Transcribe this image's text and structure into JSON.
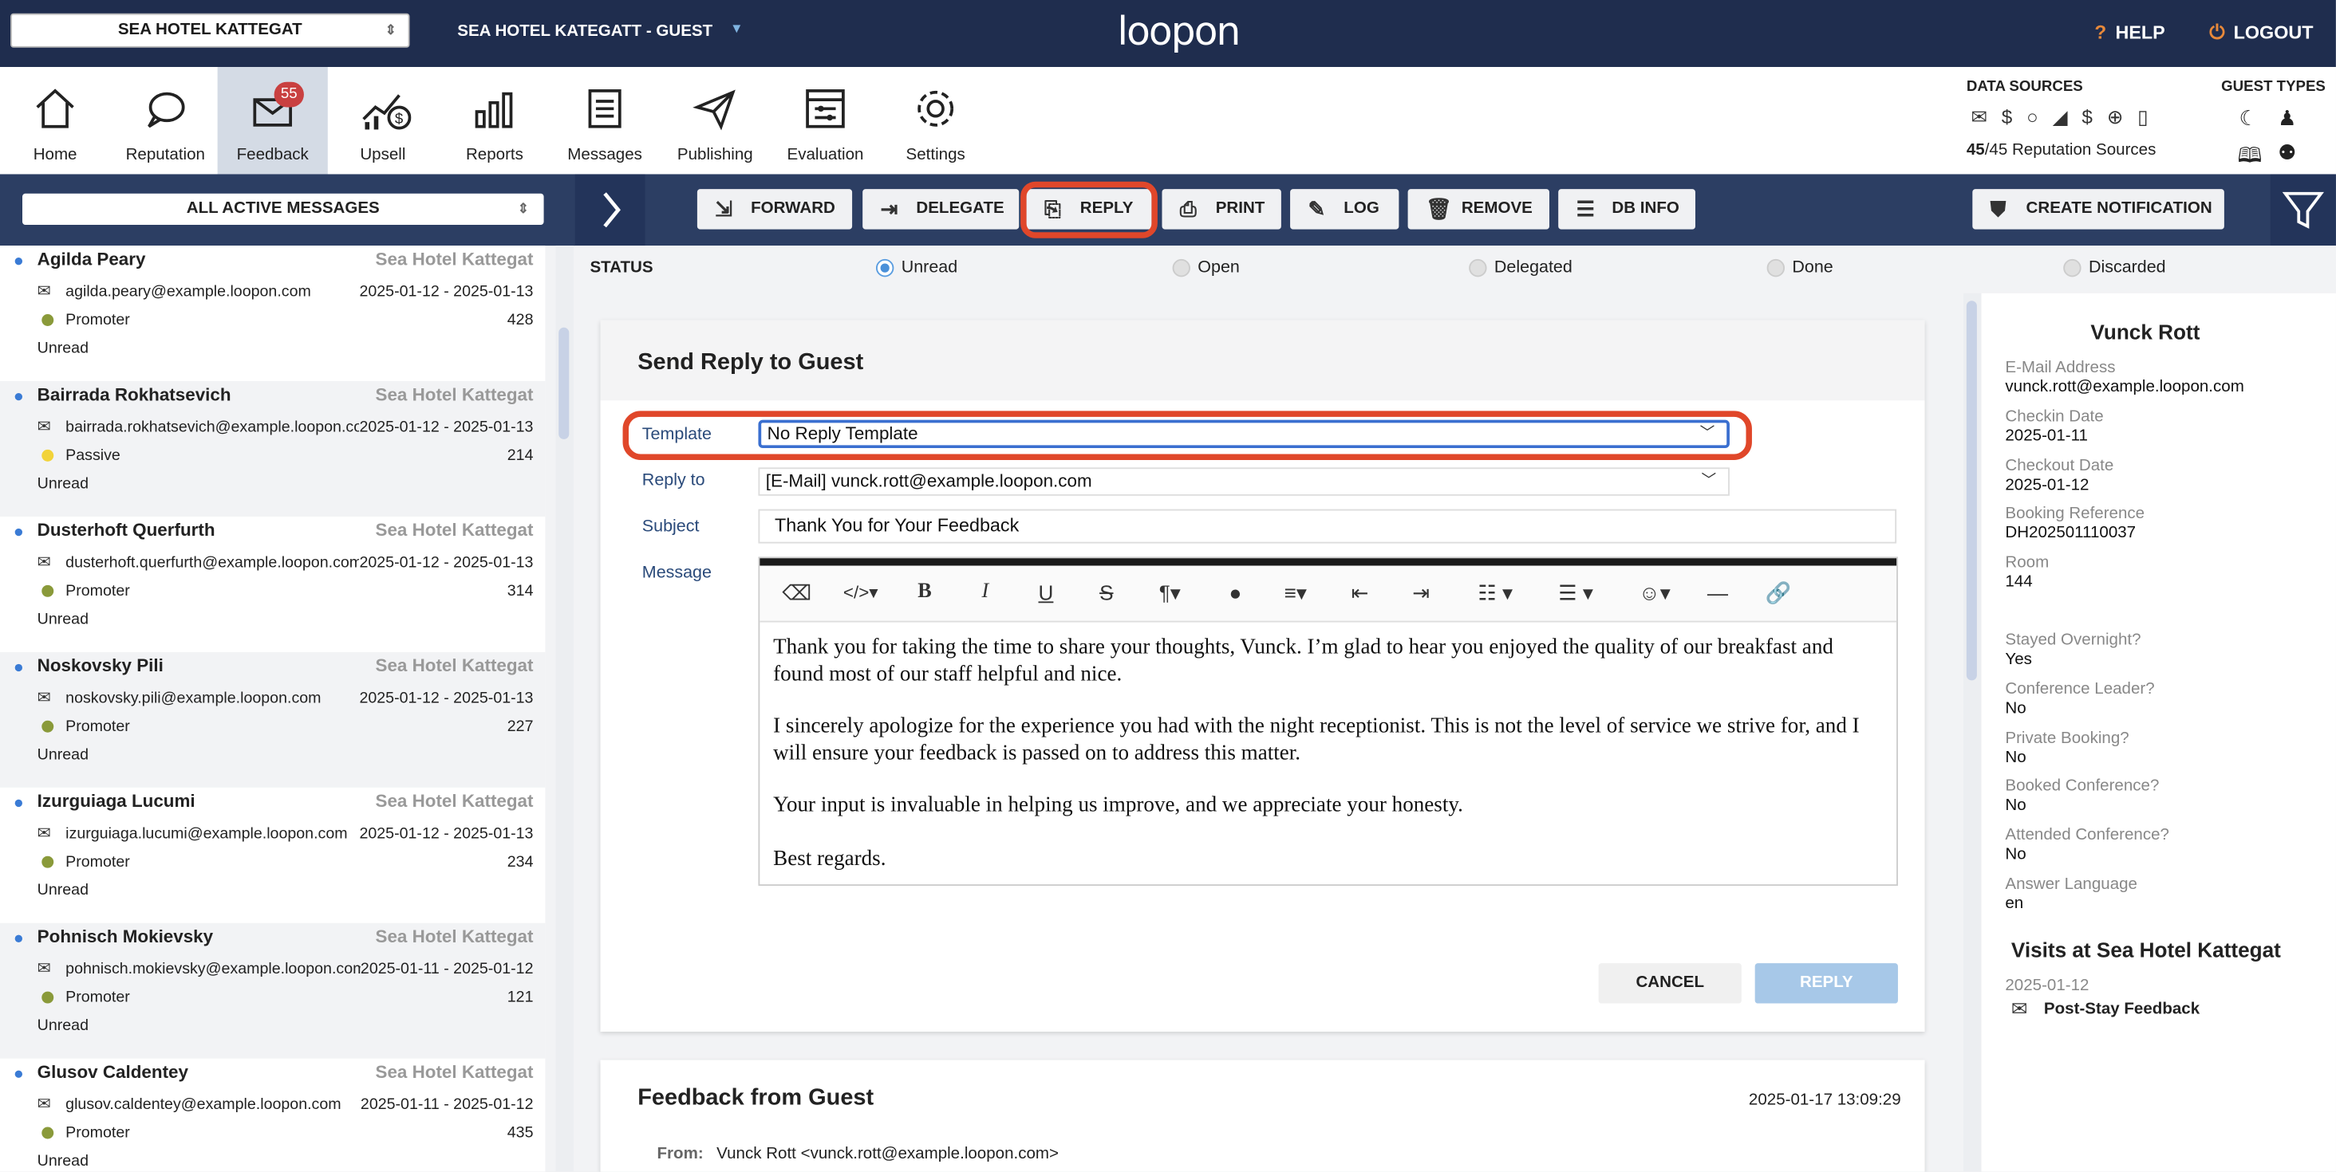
{
  "header": {
    "hotel_select": "SEA HOTEL KATTEGAT",
    "guest_title": "SEA HOTEL KATEGATT - GUEST",
    "logo": "loopon",
    "help": "HELP",
    "logout": "LOGOUT"
  },
  "nav": {
    "items": [
      {
        "label": "Home",
        "icon": "home-icon"
      },
      {
        "label": "Reputation",
        "icon": "chat-bubble-icon"
      },
      {
        "label": "Feedback",
        "icon": "feedback-inbox-icon",
        "badge": "55"
      },
      {
        "label": "Upsell",
        "icon": "upsell-chart-icon"
      },
      {
        "label": "Reports",
        "icon": "bar-chart-icon"
      },
      {
        "label": "Messages",
        "icon": "document-icon"
      },
      {
        "label": "Publishing",
        "icon": "paper-plane-icon"
      },
      {
        "label": "Evaluation",
        "icon": "evaluation-icon"
      },
      {
        "label": "Settings",
        "icon": "gear-icon"
      }
    ],
    "data_sources_title": "DATA SOURCES",
    "guest_types_title": "GUEST TYPES",
    "data_sources_icons": "✉ $ ○ ◢ $ ⊕ ▯",
    "reputation_sources_count": "45",
    "reputation_sources_rest": "/45 Reputation Sources"
  },
  "toolbar": {
    "message_filter": "ALL ACTIVE MESSAGES",
    "forward": "FORWARD",
    "delegate": "DELEGATE",
    "reply": "REPLY",
    "print": "PRINT",
    "log": "LOG",
    "remove": "REMOVE",
    "db_info": "DB INFO",
    "create_notification": "CREATE NOTIFICATION"
  },
  "messages": [
    {
      "name": "Agilda Peary",
      "hotel": "Sea Hotel Kattegat",
      "email": "agilda.peary@example.loopon.com",
      "dates": "2025-01-12 - 2025-01-13",
      "type": "Promoter",
      "type_color": "#8a9a3a",
      "number": "428",
      "state": "Unread"
    },
    {
      "name": "Bairrada Rokhatsevich",
      "hotel": "Sea Hotel Kattegat",
      "email": "bairrada.rokhatsevich@example.loopon.com",
      "dates": "2025-01-12 - 2025-01-13",
      "type": "Passive",
      "type_color": "#f2d33a",
      "number": "214",
      "state": "Unread"
    },
    {
      "name": "Dusterhoft Querfurth",
      "hotel": "Sea Hotel Kattegat",
      "email": "dusterhoft.querfurth@example.loopon.com",
      "dates": "2025-01-12 - 2025-01-13",
      "type": "Promoter",
      "type_color": "#8a9a3a",
      "number": "314",
      "state": "Unread"
    },
    {
      "name": "Noskovsky Pili",
      "hotel": "Sea Hotel Kattegat",
      "email": "noskovsky.pili@example.loopon.com",
      "dates": "2025-01-12 - 2025-01-13",
      "type": "Promoter",
      "type_color": "#8a9a3a",
      "number": "227",
      "state": "Unread"
    },
    {
      "name": "Izurguiaga Lucumi",
      "hotel": "Sea Hotel Kattegat",
      "email": "izurguiaga.lucumi@example.loopon.com",
      "dates": "2025-01-12 - 2025-01-13",
      "type": "Promoter",
      "type_color": "#8a9a3a",
      "number": "234",
      "state": "Unread"
    },
    {
      "name": "Pohnisch Mokievsky",
      "hotel": "Sea Hotel Kattegat",
      "email": "pohnisch.mokievsky@example.loopon.com",
      "dates": "2025-01-11 - 2025-01-12",
      "type": "Promoter",
      "type_color": "#8a9a3a",
      "number": "121",
      "state": "Unread"
    },
    {
      "name": "Glusov Caldentey",
      "hotel": "Sea Hotel Kattegat",
      "email": "glusov.caldentey@example.loopon.com",
      "dates": "2025-01-11 - 2025-01-12",
      "type": "Promoter",
      "type_color": "#8a9a3a",
      "number": "435",
      "state": "Unread"
    }
  ],
  "status": {
    "label": "STATUS",
    "options": [
      "Unread",
      "Open",
      "Delegated",
      "Done",
      "Discarded"
    ],
    "selected": "Unread"
  },
  "reply_form": {
    "title": "Send Reply to Guest",
    "template_label": "Template",
    "template_value": "No Reply Template",
    "reply_to_label": "Reply to",
    "reply_to_value": "[E-Mail] vunck.rott@example.loopon.com",
    "subject_label": "Subject",
    "subject_value": "Thank You for Your Feedback",
    "message_label": "Message",
    "message_paragraphs": [
      "Thank you for taking the time to share your thoughts, Vunck. I’m glad to hear you enjoyed the quality of our breakfast and found most of our staff helpful and nice.",
      "I sincerely apologize for the experience you had with the night receptionist. This is not the level of service we strive for, and I will ensure your feedback is passed on to address this matter.",
      "Your input is invaluable in helping us improve, and we appreciate your honesty.",
      "Best regards."
    ],
    "cancel": "CANCEL",
    "reply": "REPLY"
  },
  "feedback": {
    "title": "Feedback from Guest",
    "date": "2025-01-17 13:09:29",
    "from_label": "From:",
    "from_value": "Vunck Rott <vunck.rott@example.loopon.com>"
  },
  "guest": {
    "name": "Vunck Rott",
    "fields": [
      {
        "label": "E-Mail Address",
        "value": "vunck.rott@example.loopon.com"
      },
      {
        "label": "Checkin Date",
        "value": "2025-01-11"
      },
      {
        "label": "Checkout Date",
        "value": "2025-01-12"
      },
      {
        "label": "Booking Reference",
        "value": "DH202501110037"
      },
      {
        "label": "Room",
        "value": "144"
      },
      {
        "label": "Stayed Overnight?",
        "value": "Yes"
      },
      {
        "label": "Conference Leader?",
        "value": "No"
      },
      {
        "label": "Private Booking?",
        "value": "No"
      },
      {
        "label": "Booked Conference?",
        "value": "No"
      },
      {
        "label": "Attended Conference?",
        "value": "No"
      },
      {
        "label": "Answer Language",
        "value": "en"
      }
    ],
    "visits_title": "Visits at Sea Hotel Kattegat",
    "visit_date": "2025-01-12",
    "visit_item": "Post-Stay Feedback"
  }
}
